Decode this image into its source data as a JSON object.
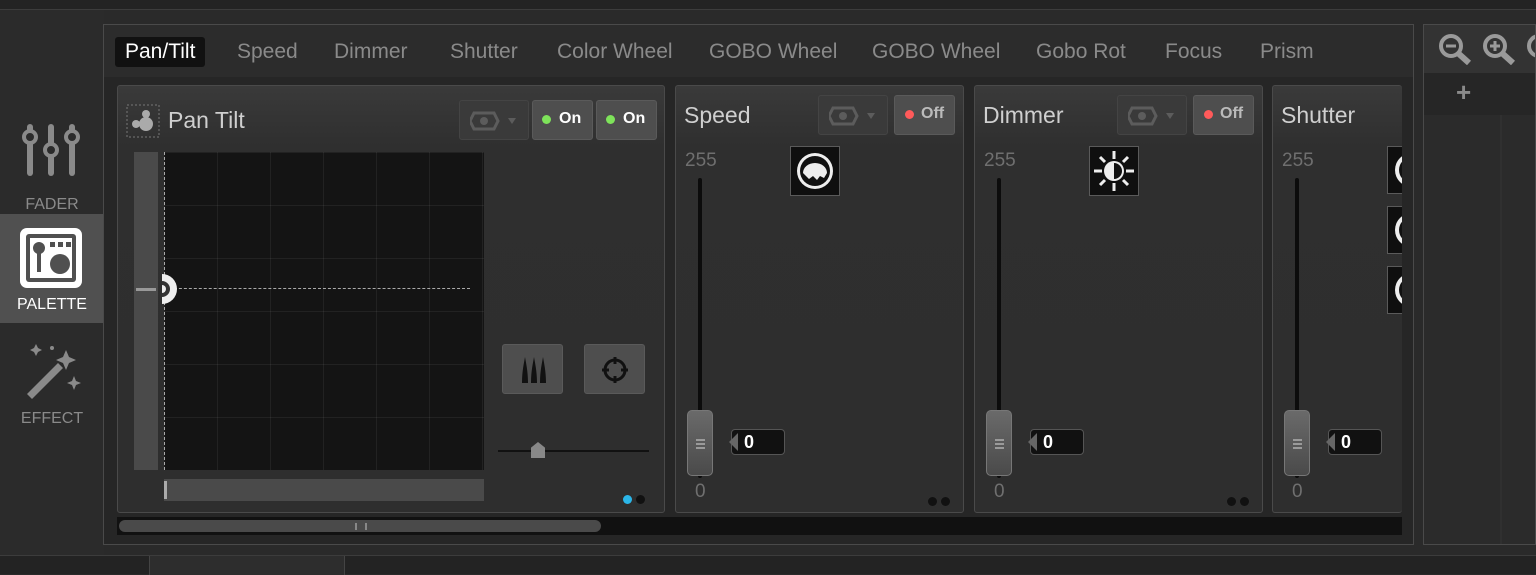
{
  "sidebar": {
    "items": [
      {
        "label": "FADER",
        "icon": "sliders-icon",
        "active": false
      },
      {
        "label": "PALETTE",
        "icon": "palette-icon",
        "active": true
      },
      {
        "label": "EFFECT",
        "icon": "magic-wand-icon",
        "active": false
      }
    ]
  },
  "tabs": [
    "Pan/Tilt",
    "Speed",
    "Dimmer",
    "Shutter",
    "Color Wheel",
    "GOBO Wheel",
    "GOBO Wheel",
    "Gobo Rot",
    "Focus",
    "Prism"
  ],
  "active_tab": "Pan/Tilt",
  "pantilt": {
    "title": "Pan Tilt",
    "toggle1": "On",
    "toggle2": "On"
  },
  "speed": {
    "title": "Speed",
    "toggle": "Off",
    "max": "255",
    "min": "0",
    "value": "0"
  },
  "dimmer": {
    "title": "Dimmer",
    "toggle": "Off",
    "max": "255",
    "min": "0",
    "value": "0"
  },
  "shutter": {
    "title": "Shutter",
    "max": "255",
    "min": "0",
    "value": "0"
  },
  "right": {
    "add": "+"
  },
  "colors": {
    "on_dot": "#7ee35a",
    "off_dot": "#ff5a5a",
    "page_active": "#2bb6e8"
  }
}
